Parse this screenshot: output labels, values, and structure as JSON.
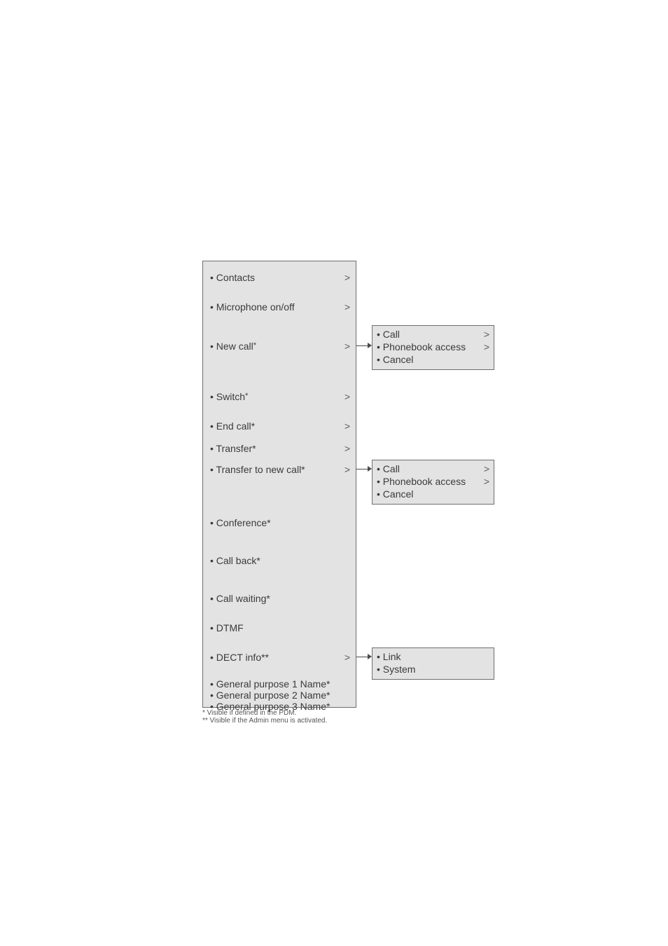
{
  "main_menu": {
    "items": [
      {
        "label": "• Contacts",
        "chevron": ">"
      },
      {
        "label": "• Microphone on/off",
        "chevron": ">"
      },
      {
        "label_pre": "• New call",
        "star": "*",
        "chevron": ">"
      },
      {
        "label_pre": "• Switch",
        "star": "*",
        "chevron": ">"
      },
      {
        "label": "• End call*",
        "chevron": ">"
      },
      {
        "label": "• Transfer*",
        "chevron": ">"
      },
      {
        "label": "• Transfer to new call*",
        "chevron": ">"
      },
      {
        "label": "• Conference*"
      },
      {
        "label": "• Call back*"
      },
      {
        "label": "• Call waiting*"
      },
      {
        "label": "• DTMF"
      },
      {
        "label": "• DECT info**",
        "chevron": ">"
      },
      {
        "label": "• General purpose 1 Name*"
      },
      {
        "label": "• General purpose 2 Name*"
      },
      {
        "label": "• General purpose 3 Name*"
      }
    ]
  },
  "sub_newcall": {
    "items": [
      {
        "label": "• Call",
        "chevron": ">"
      },
      {
        "label": "• Phonebook access",
        "chevron": ">"
      },
      {
        "label": "• Cancel"
      }
    ]
  },
  "sub_transfer_newcall": {
    "items": [
      {
        "label": "• Call",
        "chevron": ">"
      },
      {
        "label": "• Phonebook access",
        "chevron": ">"
      },
      {
        "label": "• Cancel"
      }
    ]
  },
  "sub_dectinfo": {
    "items": [
      {
        "label": "• Link"
      },
      {
        "label": "• System"
      }
    ]
  },
  "footnotes": {
    "fn1": "* Visible if defined in the PDM.",
    "fn2": "** Visible if the Admin menu is activated."
  }
}
